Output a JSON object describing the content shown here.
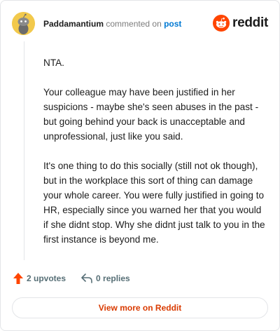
{
  "comment": {
    "author": "Paddamantium",
    "action_text": "commented on",
    "target_link": "post",
    "paragraphs": [
      "NTA.",
      "Your colleague may have been justified in her suspicions - maybe she's seen abuses in the past - but going behind your back is unacceptable and unprofessional, just like you said.",
      "It's one thing to do this socially (still not ok though), but in the workplace this sort of thing can damage your whole career. You were fully justified in going to HR, especially since you warned her that you would if she didnt stop. Why she didnt just talk to you in the first instance is beyond me."
    ]
  },
  "brand": {
    "name": "reddit",
    "icon": "reddit-logo-icon",
    "color": "#ff4500"
  },
  "actions": {
    "upvotes": "2 upvotes",
    "replies": "0 replies",
    "upvote_color": "#ff4500"
  },
  "footer": {
    "view_more": "View more on Reddit"
  }
}
